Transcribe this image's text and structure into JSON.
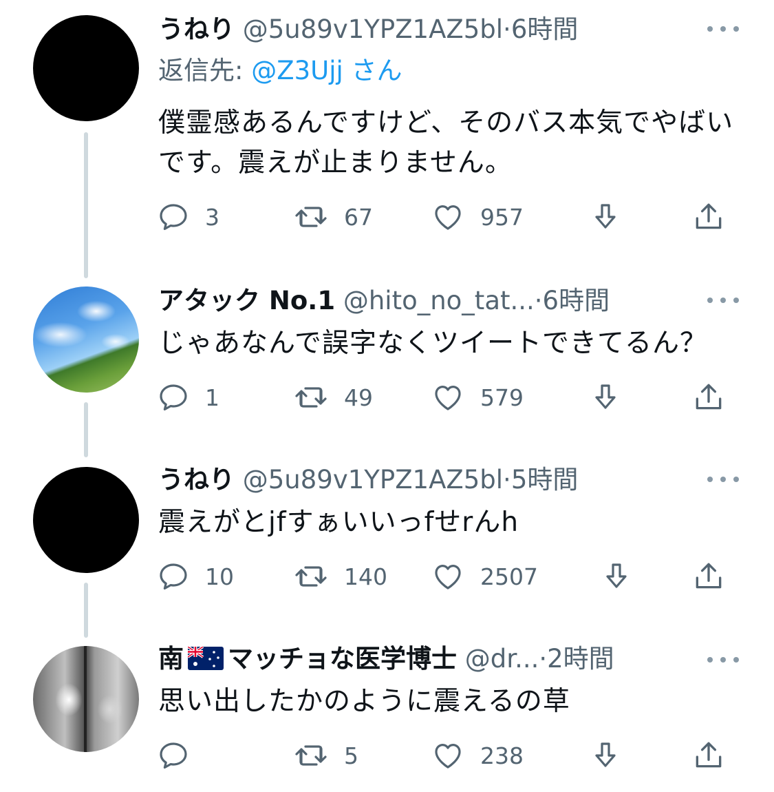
{
  "tweets": [
    {
      "name": "うねり",
      "handle": "@5u89v1YPZ1AZ5bl",
      "separator": "·",
      "time": "6時間",
      "reply_label": "返信先:",
      "reply_mention": "@Z3Ujj",
      "reply_suffix": "さん",
      "body": "僕霊感あるんですけど、そのバス本気でやばいです。震えが止まりません。",
      "replies": "3",
      "retweets": "67",
      "likes": "957",
      "avatar": "black-circle"
    },
    {
      "name": "アタック No.1",
      "handle": "@hito_no_tat...",
      "separator": "·",
      "time": "6時間",
      "body": "じゃあなんで誤字なくツイートできてるん？",
      "replies": "1",
      "retweets": "49",
      "likes": "579",
      "avatar": "sky-field-photo"
    },
    {
      "name": "うねり",
      "handle": "@5u89v1YPZ1AZ5bl",
      "separator": "·",
      "time": "5時間",
      "body": "震えがとjfすぁいいっfせrんh",
      "replies": "10",
      "retweets": "140",
      "likes": "2507",
      "avatar": "black-circle"
    },
    {
      "name_part1": "南",
      "name_part2": "マッチョな医学博士",
      "handle": "@dr...",
      "separator": "·",
      "time": "2時間",
      "body": "思い出したかのように震えるの草",
      "replies": "",
      "retweets": "5",
      "likes": "238",
      "avatar": "muscle-photo",
      "flag": "australia-flag-icon"
    }
  ],
  "colors": {
    "text": "#0f1419",
    "secondary": "#536471",
    "mention": "#1d9bf0",
    "thread_line": "#cfd9de"
  }
}
